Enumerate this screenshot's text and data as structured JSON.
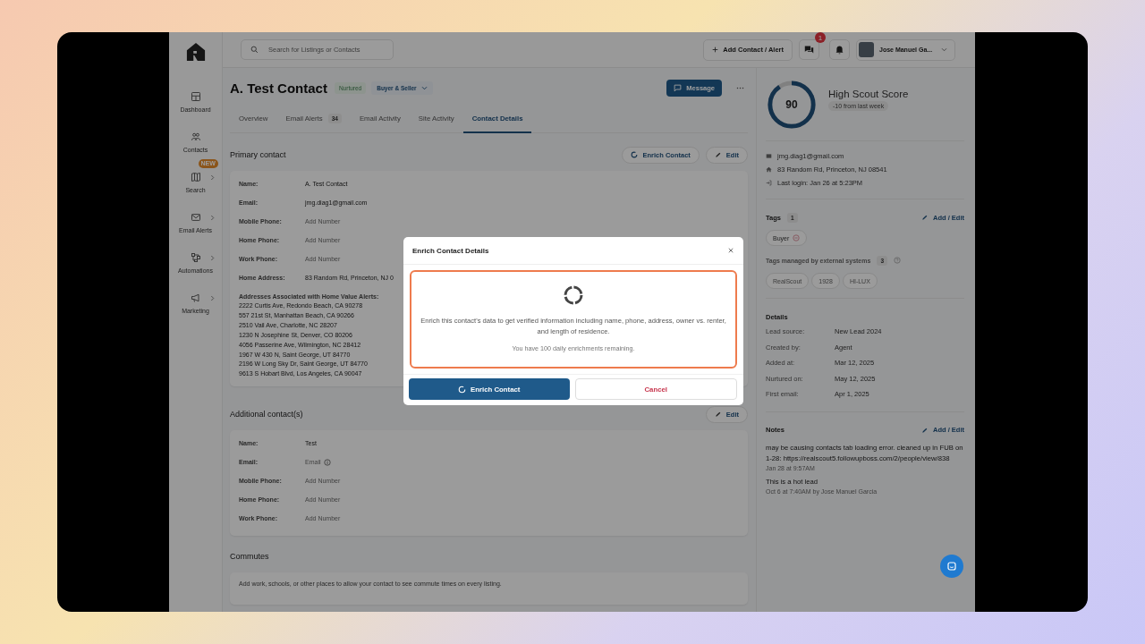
{
  "header": {
    "search": {
      "placeholder": "Search for Listings or Contacts"
    },
    "add_button": "Add Contact / Alert",
    "messages_badge": "1",
    "user_name": "Jose Manuel Ga..."
  },
  "sidebar": {
    "items": [
      {
        "label": "Dashboard",
        "submenu": false
      },
      {
        "label": "Contacts",
        "submenu": false
      },
      {
        "label": "Search",
        "submenu": true,
        "badge": "NEW"
      },
      {
        "label": "Email Alerts",
        "submenu": true
      },
      {
        "label": "Automations",
        "submenu": true
      },
      {
        "label": "Marketing",
        "submenu": true
      }
    ]
  },
  "contact": {
    "name": "A. Test Contact",
    "status": "Nurtured",
    "type": "Buyer & Seller",
    "message_button": "Message"
  },
  "tabs": [
    {
      "label": "Overview",
      "selected": false
    },
    {
      "label": "Email Alerts",
      "count": "34",
      "selected": false
    },
    {
      "label": "Email Activity",
      "selected": false
    },
    {
      "label": "Site Activity",
      "selected": false
    },
    {
      "label": "Contact Details",
      "selected": true
    }
  ],
  "primary": {
    "title": "Primary contact",
    "enrich_button": "Enrich Contact",
    "edit_button": "Edit",
    "fields": [
      {
        "label": "Name:",
        "value": "A. Test Contact",
        "empty": false
      },
      {
        "label": "Email:",
        "value": "jmg.diag1@gmail.com",
        "empty": false
      },
      {
        "label": "Mobile Phone:",
        "value": "Add Number",
        "empty": true
      },
      {
        "label": "Home Phone:",
        "value": "Add Number",
        "empty": true
      },
      {
        "label": "Work Phone:",
        "value": "Add Number",
        "empty": true
      },
      {
        "label": "Home Address:",
        "value": "83 Random Rd, Princeton, NJ 0",
        "empty": false
      }
    ],
    "addresses_title": "Addresses Associated with Home Value Alerts:",
    "addresses": [
      "2222 Curtis Ave, Redondo Beach, CA 90278",
      "557 21st St, Manhattan Beach, CA 90266",
      "2510 Vail Ave, Charlotte, NC 28207",
      "1230 N Josephine St, Denver, CO 80206",
      "4056 Passerine Ave, Wilmington, NC 28412",
      "1967 W 430 N, Saint George, UT 84770",
      "2196 W Long Sky Dr, Saint George, UT 84770",
      "9613 S Hobart Blvd, Los Angeles, CA 90047"
    ]
  },
  "additional": {
    "title": "Additional contact(s)",
    "edit_button": "Edit",
    "fields": [
      {
        "label": "Name:",
        "value": "Test",
        "empty": false
      },
      {
        "label": "Email:",
        "value": "Email",
        "empty": true,
        "info": true
      },
      {
        "label": "Mobile Phone:",
        "value": "Add Number",
        "empty": true
      },
      {
        "label": "Home Phone:",
        "value": "Add Number",
        "empty": true
      },
      {
        "label": "Work Phone:",
        "value": "Add Number",
        "empty": true
      }
    ]
  },
  "commutes": {
    "title": "Commutes",
    "description": "Add work, schools, or other places to allow your contact to see commute times on every listing."
  },
  "score": {
    "value": "90",
    "level": 0.9,
    "title": "High Scout Score",
    "change": "-10 from last week"
  },
  "contact_info": [
    {
      "text": "jmg.diag1@gmail.com"
    },
    {
      "text": "83 Random Rd, Princeton, NJ 08541"
    },
    {
      "text": "Last login: Jan 26 at 5:23PM"
    }
  ],
  "tags": {
    "title": "Tags",
    "count": "1",
    "edit": "Add / Edit",
    "items": [
      "Buyer"
    ],
    "external_title": "Tags managed by external systems",
    "external_count": "3",
    "external_items": [
      "RealScout",
      "1928",
      "HI-LUX"
    ]
  },
  "details": {
    "title": "Details",
    "rows": [
      {
        "label": "Lead source:",
        "value": "New Lead 2024"
      },
      {
        "label": "Created by:",
        "value": "Agent"
      },
      {
        "label": "Added at:",
        "value": "Mar 12, 2025"
      },
      {
        "label": "Nurtured on:",
        "value": "May 12, 2025"
      },
      {
        "label": "First email:",
        "value": "Apr 1, 2025"
      }
    ]
  },
  "notes": {
    "title": "Notes",
    "edit": "Add / Edit",
    "items": [
      {
        "text": "may be causing contacts tab loading error. cleaned up in FUB on 1-28: https://realscout5.followupboss.com/2/people/view/838",
        "meta": "Jan 28 at 9:57AM"
      },
      {
        "text": "This is a hot lead",
        "meta": "Oct 6 at 7:40AM by Jose Manuel Garcia"
      }
    ]
  },
  "modal": {
    "title": "Enrich Contact Details",
    "description": "Enrich this contact's data to get verified information including name, phone, address, owner vs. renter, and length of residence.",
    "remaining": "You have 100 daily enrichments remaining.",
    "confirm": "Enrich Contact",
    "cancel": "Cancel"
  }
}
